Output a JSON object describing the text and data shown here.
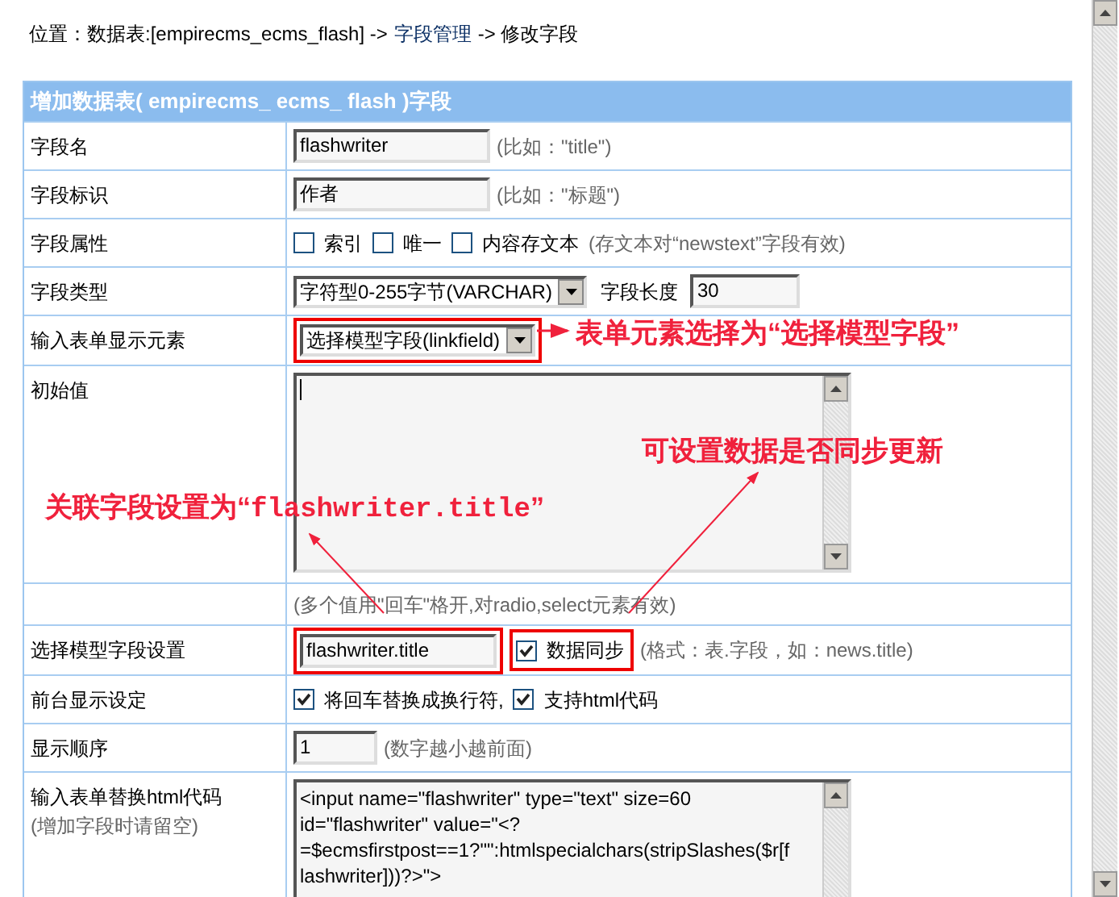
{
  "breadcrumb": {
    "prefix": "位置：数据表:[empirecms_ecms_flash] ->",
    "link": "字段管理",
    "suffix": "-> 修改字段"
  },
  "form": {
    "title": "增加数据表( empirecms_ ecms_ flash )字段",
    "rows": [
      {
        "kind": "input",
        "label": "字段名",
        "value": "flashwriter",
        "hint": "(比如：\"title\")"
      },
      {
        "kind": "input",
        "label": "字段标识",
        "value": "作者",
        "hint": "(比如：\"标题\")"
      },
      {
        "kind": "checks",
        "label": "字段属性",
        "checks": [
          {
            "label": "索引",
            "checked": false
          },
          {
            "label": "唯一",
            "checked": false
          },
          {
            "label": "内容存文本",
            "checked": false
          }
        ],
        "hint": "(存文本对“newstext”字段有效)"
      },
      {
        "kind": "type",
        "label": "字段类型",
        "select": "字符型0-255字节(VARCHAR)",
        "length_label": "字段长度",
        "length": "30"
      },
      {
        "kind": "select",
        "label": "输入表单显示元素",
        "select": "选择模型字段(linkfield)",
        "highlighted": true
      },
      {
        "kind": "textarea",
        "label": "初始值",
        "value": ""
      },
      {
        "kind": "note",
        "hint": "(多个值用\"回车\"格开,对radio,select元素有效)"
      },
      {
        "kind": "link",
        "label": "选择模型字段设置",
        "value": "flashwriter.title",
        "highlighted": true,
        "check": {
          "label": "数据同步",
          "checked": true,
          "highlighted": true
        },
        "hint": "(格式：表.字段，如：news.title)"
      },
      {
        "kind": "checks",
        "label": "前台显示设定",
        "checks": [
          {
            "label": "将回车替换成换行符,",
            "checked": true
          },
          {
            "label": "支持html代码",
            "checked": true
          }
        ]
      },
      {
        "kind": "input",
        "label": "显示顺序",
        "value": "1",
        "hint": "(数字越小越前面)",
        "short": true
      },
      {
        "kind": "code",
        "label": "输入表单替换html代码",
        "sublabel": "(增加字段时请留空)",
        "value": "<input name=\"flashwriter\" type=\"text\" size=60 id=\"flashwriter\" value=\"<?=$ecmsfirstpost==1?\"\":htmlspecialchars(stripSlashes($r[flashwriter]))?>\">"
      }
    ]
  },
  "annotations": [
    {
      "text": "表单元素选择为“选择模型字段”"
    },
    {
      "text": "可设置数据是否同步更新"
    },
    {
      "prefix": "关联字段设置为“",
      "code": "flashwriter.title",
      "suffix": "”"
    }
  ]
}
